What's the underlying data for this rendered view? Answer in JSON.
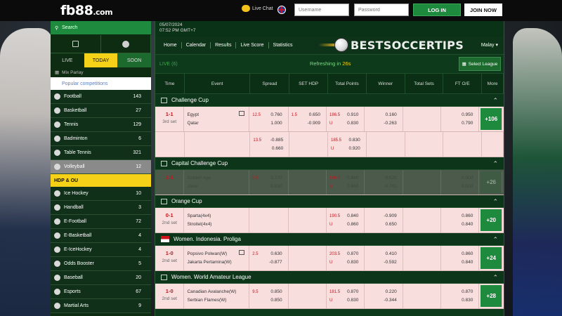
{
  "brand": {
    "logo_main": "fb88",
    "logo_dotcom": ".com"
  },
  "header": {
    "live_chat": "Live Chat",
    "username_placeholder": "Username",
    "password_placeholder": "Password",
    "login": "LOG IN",
    "join": "JOIN NOW"
  },
  "sidebar": {
    "search": "Search",
    "tabs": [
      "LIVE",
      "TODAY",
      "SOON"
    ],
    "mix_parlay": "Mix Parlay",
    "popular": "Popular competitions",
    "sports_top": [
      {
        "name": "Football",
        "count": "143"
      },
      {
        "name": "Basketball",
        "count": "27"
      },
      {
        "name": "Tennis",
        "count": "129"
      },
      {
        "name": "Badminton",
        "count": "6"
      },
      {
        "name": "Table Tennis",
        "count": "321"
      },
      {
        "name": "Volleyball",
        "count": "12"
      }
    ],
    "hdp_ou": "HDP & OU",
    "sports_bottom": [
      {
        "name": "Ice Hockey",
        "count": "10"
      },
      {
        "name": "Handball",
        "count": "3"
      },
      {
        "name": "E-Football",
        "count": "72"
      },
      {
        "name": "E-Basketball",
        "count": "4"
      },
      {
        "name": "E-IceHockey",
        "count": "4"
      },
      {
        "name": "Odds Booster",
        "count": "5"
      },
      {
        "name": "Baseball",
        "count": "20"
      },
      {
        "name": "Esports",
        "count": "67"
      },
      {
        "name": "Martial Arts",
        "count": "9"
      }
    ]
  },
  "main": {
    "date": "05/07/2024",
    "time": "07:52 PM GMT+7",
    "nav": [
      "Home",
      "Calendar",
      "Results",
      "Live Score",
      "Statistics"
    ],
    "watermark": "BESTSOCCERTIPS",
    "language": "Malay",
    "live_label": "LIVE (6)",
    "refresh_prefix": "Refreshing in",
    "refresh_value": "26s",
    "select_league": "Select League",
    "columns": [
      "Time",
      "Event",
      "Spread",
      "SET HDP",
      "Total Points",
      "Winner",
      "Total Sets",
      "FT O/E",
      "More"
    ]
  },
  "leagues": [
    {
      "name": "Challenge Cup",
      "rows": [
        {
          "score": "1-1",
          "period": "3rd set",
          "team1": "Egypt",
          "team2": "Qatar",
          "spread_hd": "12.5",
          "spread1": "0.760",
          "spread2": "1.000",
          "set_hd": "1.5",
          "set1": "0.650",
          "set2": "-0.909",
          "tp_hd": "186.5",
          "tp_u": "U",
          "tp1": "0.910",
          "tp2": "0.830",
          "win1": "0.160",
          "win2": "-0.263",
          "oe1": "0.950",
          "oe2": "0.790",
          "more": "+106"
        },
        {
          "score": "",
          "period": "",
          "team1": "",
          "team2": "",
          "spread_hd": "13.5",
          "spread1": "-0.885",
          "spread2": "0.660",
          "set_hd": "",
          "set1": "",
          "set2": "",
          "tp_hd": "185.5",
          "tp_u": "U",
          "tp1": "0.830",
          "tp2": "0.920",
          "win1": "",
          "win2": "",
          "oe1": "",
          "oe2": "",
          "more": ""
        }
      ]
    },
    {
      "name": "Capital Challenge Cup",
      "rows": [
        {
          "score": "1-1",
          "period": "",
          "team1": "Golden Age",
          "team2": "Joker",
          "spread_hd": "0.5",
          "spread1": "0.770",
          "spread2": "0.930",
          "set_hd": "",
          "set1": "",
          "set2": "",
          "tp_hd": "186.5",
          "tp_u": "U",
          "tp1": "0.840",
          "tp2": "0.860",
          "win1": "0.520",
          "win2": "-0.741",
          "oe1": "0.900",
          "oe2": "0.800",
          "more": "+26"
        }
      ]
    },
    {
      "name": "Orange Cup",
      "rows": [
        {
          "score": "0-1",
          "period": "2nd set",
          "team1": "Sparta(4x4)",
          "team2": "Stroitel(4x4)",
          "spread_hd": "",
          "spread1": "",
          "spread2": "",
          "set_hd": "",
          "set1": "",
          "set2": "",
          "tp_hd": "190.5",
          "tp_u": "U",
          "tp1": "0.840",
          "tp2": "0.860",
          "win1": "-0.909",
          "win2": "0.650",
          "oe1": "0.860",
          "oe2": "0.840",
          "more": "+20"
        }
      ]
    },
    {
      "name": "Women. Indonesia. Proliga",
      "rows": [
        {
          "score": "1-0",
          "period": "2nd set",
          "team1": "Popsivo Polwan(W)",
          "team2": "Jakarta Pertamina(W)",
          "spread_hd": "2.5",
          "spread1": "0.630",
          "spread2": "-0.877",
          "set_hd": "",
          "set1": "",
          "set2": "",
          "tp_hd": "203.5",
          "tp_u": "U",
          "tp1": "0.870",
          "tp2": "0.830",
          "win1": "0.410",
          "win2": "-0.592",
          "oe1": "0.860",
          "oe2": "0.840",
          "more": "+24"
        }
      ]
    },
    {
      "name": "Women. World Amateur League",
      "rows": [
        {
          "score": "1-0",
          "period": "2nd set",
          "team1": "Canadian Avalanche(W)",
          "team2": "Serbian Flames(W)",
          "spread_hd": "9.5",
          "spread1": "0.850",
          "spread2": "0.850",
          "set_hd": "",
          "set1": "",
          "set2": "",
          "tp_hd": "181.5",
          "tp_u": "U",
          "tp1": "0.870",
          "tp2": "0.830",
          "win1": "0.220",
          "win2": "-0.344",
          "oe1": "0.870",
          "oe2": "0.830",
          "more": "+28"
        }
      ]
    }
  ],
  "colors": {
    "accent_green": "#1d8a3d",
    "highlight_yellow": "#f5d217",
    "score_red": "#c8141c",
    "row_pink": "#f9dede"
  }
}
